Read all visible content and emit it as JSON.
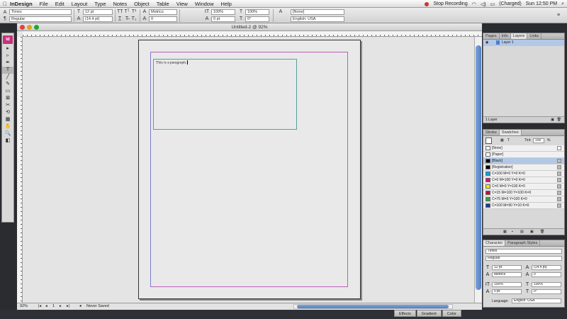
{
  "menubar": {
    "apple": "",
    "app_name": "InDesign",
    "items": [
      "File",
      "Edit",
      "Layout",
      "Type",
      "Notes",
      "Object",
      "Table",
      "View",
      "Window",
      "Help"
    ],
    "status_recording": "Stop Recording",
    "battery": "(Charged)",
    "clock": "Sun 12:50 PM"
  },
  "control": {
    "font_family": "Times",
    "font_style": "Regular",
    "font_size": "12 pt",
    "leading": "(14.4 pt)",
    "kerning": "Metrics",
    "tracking": "0",
    "vert_scale": "100%",
    "horiz_scale": "100%",
    "baseline_shift": "0 pt",
    "skew": "0°",
    "char_style": "[None]",
    "language": "English: USA"
  },
  "document": {
    "title": "Untitled-2 @ 92%",
    "frame_text": "This is a paragraph.",
    "zoom": "92%",
    "page_number": "1",
    "preflight": "Never Saved"
  },
  "tools": [
    "▸",
    "▹",
    "✒",
    "T",
    "╱",
    "✎",
    "▭",
    "⊠",
    "✂",
    "⟲",
    "▦",
    "✋",
    "🔍",
    "◧"
  ],
  "layers_panel": {
    "tabs": [
      "Pages",
      "Info",
      "Layers",
      "Links"
    ],
    "layer_name": "Layer 1",
    "footer": "1 Layer"
  },
  "swatches_panel": {
    "tabs": [
      "Stroke",
      "Swatches"
    ],
    "tint_label": "Tint:",
    "tint_value": "100",
    "tint_unit": "%",
    "swatches": [
      {
        "name": "[None]",
        "color": "#ffffff",
        "selected": false
      },
      {
        "name": "[Paper]",
        "color": "#ffffff",
        "selected": false
      },
      {
        "name": "[Black]",
        "color": "#000000",
        "selected": true
      },
      {
        "name": "[Registration]",
        "color": "#000000",
        "selected": false
      },
      {
        "name": "C=100 M=0 Y=0 K=0",
        "color": "#00a7e8",
        "selected": false
      },
      {
        "name": "C=0 M=100 Y=0 K=0",
        "color": "#e4007c",
        "selected": false
      },
      {
        "name": "C=0 M=0 Y=100 K=0",
        "color": "#ffea00",
        "selected": false
      },
      {
        "name": "C=15 M=100 Y=100 K=0",
        "color": "#c8102e",
        "selected": false
      },
      {
        "name": "C=75 M=5 Y=100 K=0",
        "color": "#2ea84a",
        "selected": false
      },
      {
        "name": "C=100 M=90 Y=10 K=0",
        "color": "#1f3a93",
        "selected": false
      }
    ]
  },
  "character_panel": {
    "tabs": [
      "Character",
      "Paragraph Styles"
    ],
    "font_family": "Times",
    "font_style": "Regular",
    "size": "12 pt",
    "leading": "(14.4 pt)",
    "kerning": "Metrics",
    "tracking": "0",
    "vert_scale": "100%",
    "horiz_scale": "100%",
    "baseline": "0 pt",
    "skew": "0°",
    "language_label": "Language:",
    "language": "English: USA"
  },
  "collapsed_panels": [
    "Effects",
    "Gradient",
    "Color"
  ]
}
